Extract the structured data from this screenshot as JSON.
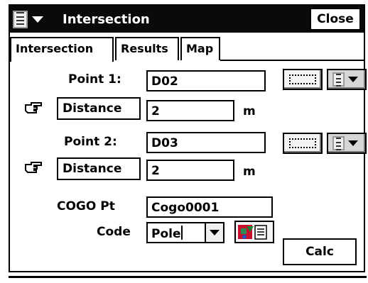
{
  "window": {
    "title": "Intersection",
    "close_label": "Close"
  },
  "tabs": [
    {
      "label": "Intersection",
      "active": true
    },
    {
      "label": "Results",
      "active": false
    },
    {
      "label": "Map",
      "active": false
    }
  ],
  "point1": {
    "label": "Point 1:",
    "value": "D02",
    "method": "Distance",
    "distance": "2",
    "unit": "m"
  },
  "point2": {
    "label": "Point 2:",
    "value": "D03",
    "method": "Distance",
    "distance": "2",
    "unit": "m"
  },
  "cogo": {
    "label": "COGO Pt",
    "value": "Cogo0001"
  },
  "code": {
    "label": "Code",
    "value": "Pole"
  },
  "calc_label": "Calc",
  "icons": {
    "menu": "document-list-icon",
    "pick": "map-pick-icon",
    "list": "point-list-icon",
    "hand": "pointing-hand-icon",
    "codes": "code-library-icon"
  }
}
